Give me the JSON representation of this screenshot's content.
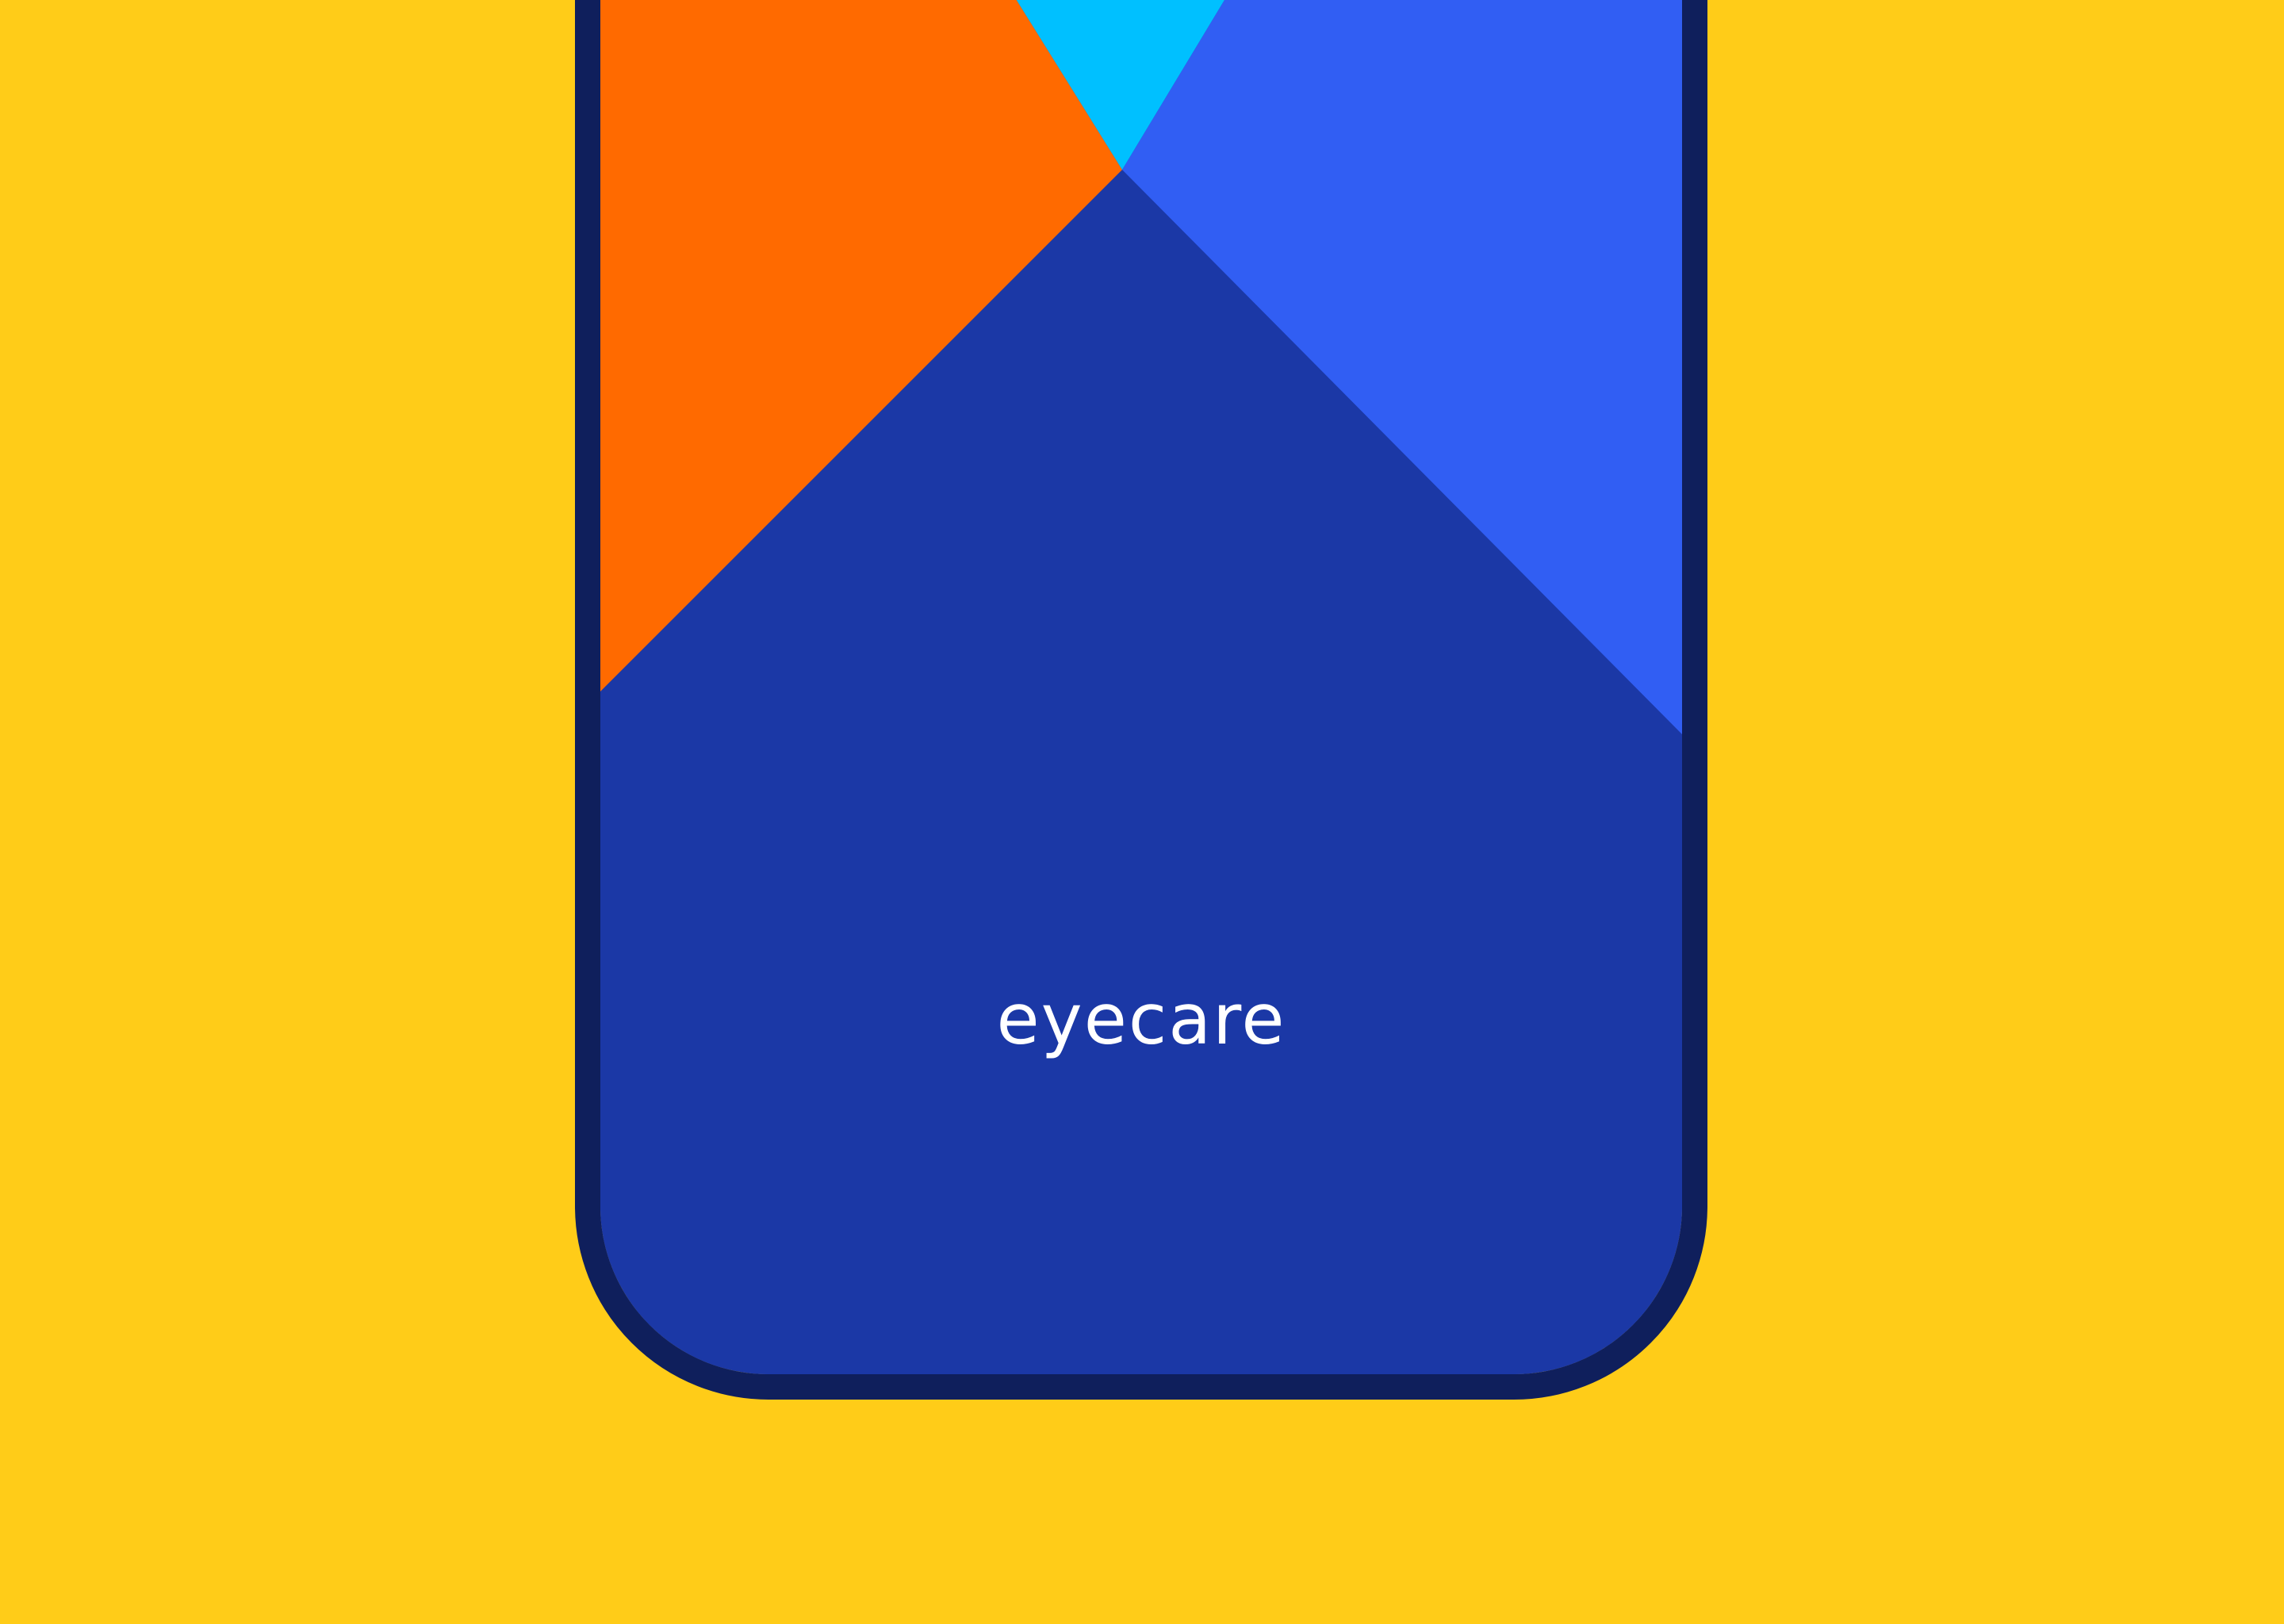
{
  "colors": {
    "background": "#ffcc18",
    "frame": "#0f1f5c",
    "screen": "#1b38a6",
    "orange_panel": "#ff6a00",
    "cyan_panel": "#00c0ff",
    "blue_panel": "#315ef3",
    "wordmark": "#ffffff"
  },
  "brand": {
    "name": "eyecare"
  }
}
